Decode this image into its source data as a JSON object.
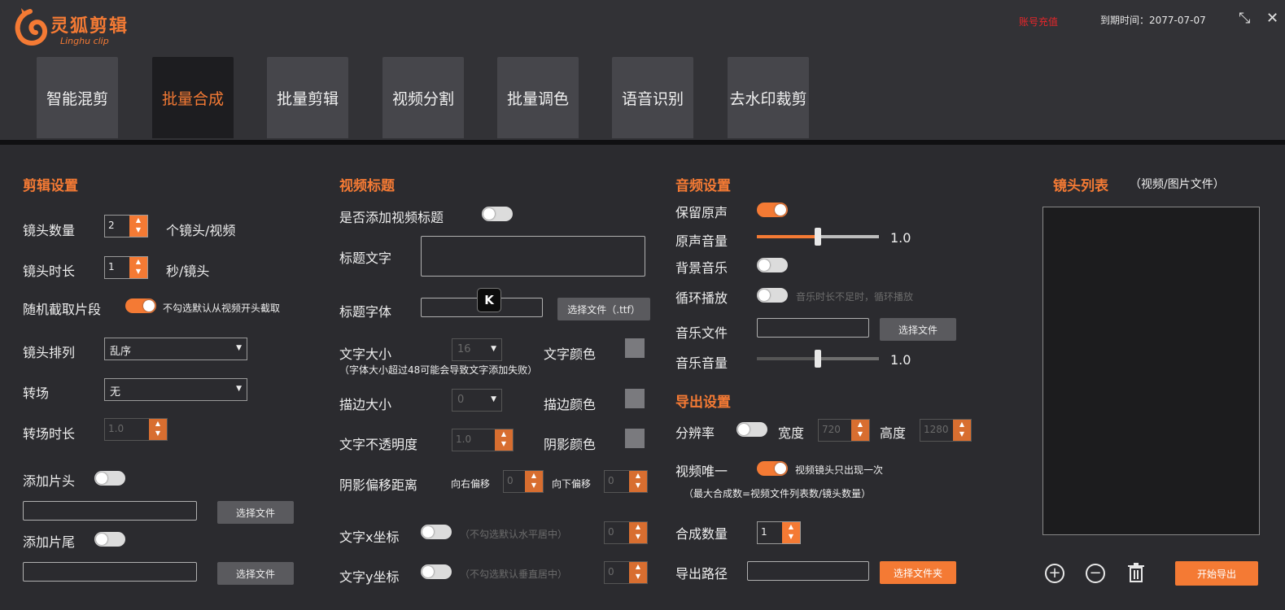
{
  "app": {
    "logo_text": "灵狐剪辑",
    "logo_sub": "Linghu clip",
    "account": "账号充值",
    "expire": "到期时间：2077-07-07"
  },
  "tabs": [
    "智能混剪",
    "批量合成",
    "批量剪辑",
    "视频分割",
    "批量调色",
    "语音识别",
    "去水印裁剪"
  ],
  "edit": {
    "title": "剪辑设置",
    "shot_count_label": "镜头数量",
    "shot_count": "2",
    "shot_count_unit": "个镜头/视频",
    "shot_len_label": "镜头时长",
    "shot_len": "1",
    "shot_len_unit": "秒/镜头",
    "random_label": "随机截取片段",
    "random_hint": "不勾选默认从视频开头截取",
    "order_label": "镜头排列",
    "order_value": "乱序",
    "trans_label": "转场",
    "trans_value": "无",
    "trans_len_label": "转场时长",
    "trans_len": "1.0",
    "head_label": "添加片头",
    "tail_label": "添加片尾",
    "choose_file": "选择文件"
  },
  "video_title": {
    "title": "视频标题",
    "add_label": "是否添加视频标题",
    "text_label": "标题文字",
    "font_label": "标题字体",
    "font_btn": "选择文件（.ttf）",
    "size_label": "文字大小",
    "size_value": "16",
    "color_label": "文字颜色",
    "size_hint": "（字体大小超过48可能会导致文字添加失败）",
    "stroke_label": "描边大小",
    "stroke_value": "0",
    "stroke_color_label": "描边颜色",
    "opacity_label": "文字不透明度",
    "opacity_value": "1.0",
    "shadow_color_label": "阴影颜色",
    "shadow_label": "阴影偏移距离",
    "shadow_right": "向右偏移",
    "shadow_right_value": "0",
    "shadow_down": "向下偏移",
    "shadow_down_value": "0",
    "x_label": "文字x坐标",
    "x_hint": "（不勾选默认水平居中）",
    "x_value": "0",
    "y_label": "文字y坐标",
    "y_hint": "（不勾选默认垂直居中）",
    "y_value": "0"
  },
  "audio": {
    "title": "音频设置",
    "keep_label": "保留原声",
    "orig_vol_label": "原声音量",
    "orig_vol": "1.0",
    "bgm_label": "背景音乐",
    "loop_label": "循环播放",
    "loop_hint": "音乐时长不足时，循环播放",
    "file_label": "音乐文件",
    "file_btn": "选择文件",
    "music_vol_label": "音乐音量",
    "music_vol": "1.0"
  },
  "export": {
    "title": "导出设置",
    "res_label": "分辨率",
    "width_label": "宽度",
    "width_value": "720",
    "height_label": "高度",
    "height_value": "1280",
    "unique_label": "视频唯一",
    "unique_hint": "视频镜头只出现一次",
    "unique_note": "（最大合成数=视频文件列表数/镜头数量）",
    "count_label": "合成数量",
    "count_value": "1",
    "path_label": "导出路径",
    "path_btn": "选择文件夹"
  },
  "shots": {
    "title": "镜头列表",
    "subtitle": "（视频/图片文件）",
    "start_btn": "开始导出"
  },
  "colors": {
    "accent": "#f47a34",
    "bg": "#2b2b2f",
    "header": "#323236"
  },
  "sliders": {
    "orig_vol_fraction": 0.5,
    "music_vol_fraction": 0.5
  }
}
